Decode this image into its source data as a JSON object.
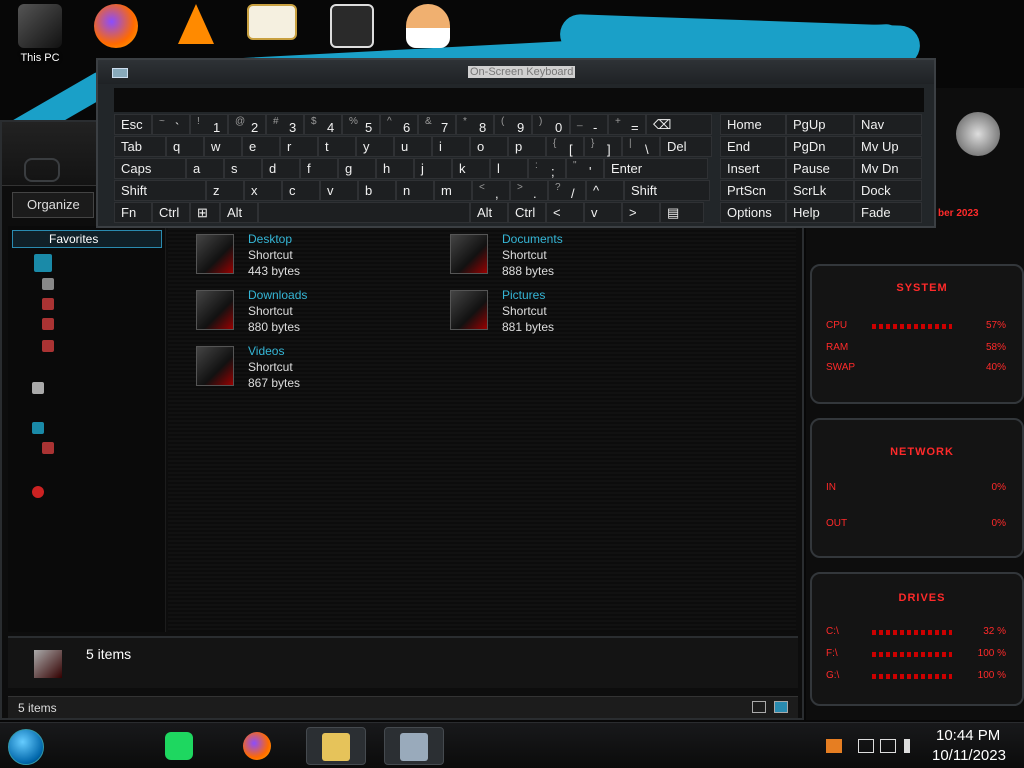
{
  "desktop": {
    "icons": [
      {
        "label": "This PC"
      },
      {
        "label": ""
      },
      {
        "label": ""
      },
      {
        "label": ""
      },
      {
        "label": ""
      },
      {
        "label": ""
      }
    ]
  },
  "osk": {
    "title": "On-Screen Keyboard",
    "rows": {
      "r1": [
        {
          "sup": "",
          "main": "Esc"
        },
        {
          "sup": "~",
          "main": "`"
        },
        {
          "sup": "!",
          "main": "1"
        },
        {
          "sup": "@",
          "main": "2"
        },
        {
          "sup": "#",
          "main": "3"
        },
        {
          "sup": "$",
          "main": "4"
        },
        {
          "sup": "%",
          "main": "5"
        },
        {
          "sup": "^",
          "main": "6"
        },
        {
          "sup": "&",
          "main": "7"
        },
        {
          "sup": "*",
          "main": "8"
        },
        {
          "sup": "(",
          "main": "9"
        },
        {
          "sup": ")",
          "main": "0"
        },
        {
          "sup": "_",
          "main": "-"
        },
        {
          "sup": "+",
          "main": "="
        },
        {
          "sup": "",
          "main": "⌫"
        }
      ],
      "r2": [
        "Tab",
        "q",
        "w",
        "e",
        "r",
        "t",
        "y",
        "u",
        "i",
        "o",
        "p",
        "[",
        "]",
        "\\",
        "Del"
      ],
      "r2sup": [
        "",
        "",
        "",
        "",
        "",
        "",
        "",
        "",
        "",
        "",
        "",
        "{",
        "}",
        "|",
        ""
      ],
      "r3": [
        "Caps",
        "a",
        "s",
        "d",
        "f",
        "g",
        "h",
        "j",
        "k",
        "l",
        ";",
        "'",
        "Enter"
      ],
      "r3sup": [
        "",
        "",
        "",
        "",
        "",
        "",
        "",
        "",
        "",
        "",
        ":",
        "\"",
        ""
      ],
      "r4": [
        "Shift",
        "z",
        "x",
        "c",
        "v",
        "b",
        "n",
        "m",
        ",",
        ".",
        "/",
        "^",
        "Shift"
      ],
      "r4sup": [
        "",
        "",
        "",
        "",
        "",
        "",
        "",
        "",
        "<",
        ">",
        "?",
        "",
        ""
      ],
      "r5": [
        "Fn",
        "Ctrl",
        "⊞",
        "Alt",
        "",
        "Alt",
        "Ctrl",
        "<",
        "v",
        ">",
        "▤"
      ]
    },
    "right_keys": [
      [
        "Home",
        "PgUp",
        "Nav"
      ],
      [
        "End",
        "PgDn",
        "Mv Up"
      ],
      [
        "Insert",
        "Pause",
        "Mv Dn"
      ],
      [
        "PrtScn",
        "ScrLk",
        "Dock"
      ],
      [
        "Options",
        "Help",
        "Fade"
      ]
    ]
  },
  "explorer": {
    "organize_label": "Organize",
    "nav": {
      "favorites": "Favorites"
    },
    "files": [
      {
        "name": "Desktop",
        "type": "Shortcut",
        "size": "443 bytes"
      },
      {
        "name": "Documents",
        "type": "Shortcut",
        "size": "888 bytes"
      },
      {
        "name": "Downloads",
        "type": "Shortcut",
        "size": "880 bytes"
      },
      {
        "name": "Pictures",
        "type": "Shortcut",
        "size": "881 bytes"
      },
      {
        "name": "Videos",
        "type": "Shortcut",
        "size": "867 bytes"
      }
    ],
    "details_text": "5 items",
    "status_text": "5 items"
  },
  "gadgets": {
    "date_text": "ber 2023",
    "system": {
      "title": "SYSTEM",
      "rows": [
        {
          "label": "CPU",
          "value": "57%"
        },
        {
          "label": "RAM",
          "value": "58%"
        },
        {
          "label": "SWAP",
          "value": "40%"
        }
      ]
    },
    "network": {
      "title": "NETWORK",
      "rows": [
        {
          "label": "IN",
          "value": "0%"
        },
        {
          "label": "OUT",
          "value": "0%"
        }
      ]
    },
    "drives": {
      "title": "DRIVES",
      "rows": [
        {
          "label": "C:\\",
          "value": "32 %"
        },
        {
          "label": "F:\\",
          "value": "100 %"
        },
        {
          "label": "G:\\",
          "value": "100 %"
        }
      ]
    }
  },
  "taskbar": {
    "time": "10:44 PM",
    "date": "10/11/2023"
  },
  "colors": {
    "accent_cyan": "#1aa0c8",
    "alien_red": "#ff2a2a",
    "link_blue": "#35b6d6"
  }
}
